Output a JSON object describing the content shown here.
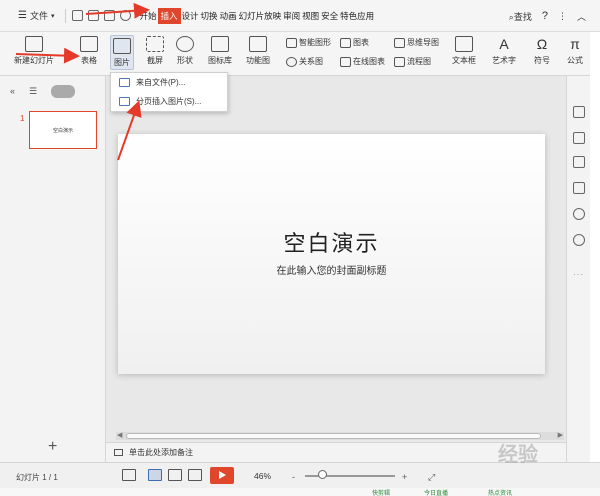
{
  "menubar": {
    "file_label": "文件",
    "tabs": [
      "开始",
      "插入",
      "设计",
      "切换",
      "动画",
      "幻灯片放映",
      "审阅",
      "视图",
      "安全",
      "特色应用"
    ],
    "active_tab": "插入",
    "search_label": "查找",
    "help": "?"
  },
  "ribbon": {
    "new_slide": "新建幻灯片",
    "table": "表格",
    "picture": "图片",
    "screenshot": "截屏",
    "shape": "形状",
    "icon_lib": "图标库",
    "func_chart": "功能图",
    "smart_graphic": "智能图形",
    "chart": "图表",
    "mindmap": "思维导图",
    "relation_chart": "关系图",
    "online_chart": "在线图表",
    "flowchart": "流程图",
    "textbox": "文本框",
    "wordart": "艺术字",
    "symbol": "符号",
    "formula": "公式"
  },
  "picture_dropdown": {
    "items": [
      "来自文件(P)...",
      "分页插入图片(S)..."
    ]
  },
  "slides_pane": {
    "thumb_number": "1",
    "thumb_title": "空白演示",
    "add": "+"
  },
  "slide": {
    "title": "空白演示",
    "subtitle": "在此输入您的封面副标题"
  },
  "notes": {
    "placeholder": "单击此处添加备注"
  },
  "statusbar": {
    "slide_count": "幻灯片 1 / 1",
    "zoom": "46%",
    "minus": "-",
    "plus": "+"
  },
  "taskbar": {
    "items": [
      "快剪辑",
      "今日直播",
      "热点资讯"
    ]
  },
  "watermark": {
    "text": "经验"
  },
  "colors": {
    "accent": "#e0462c",
    "annotation_arrow": "#e53a2a"
  }
}
